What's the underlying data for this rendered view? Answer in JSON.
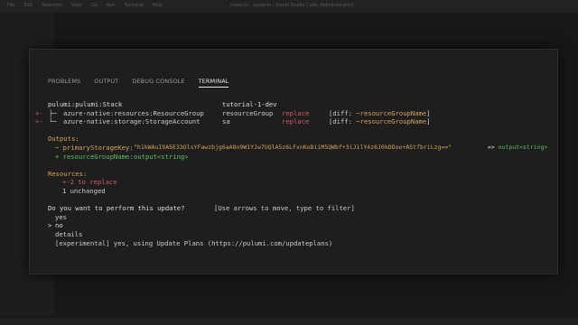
{
  "background": {
    "menu": [
      "File",
      "Edit",
      "Selection",
      "View",
      "Go",
      "Run",
      "Terminal",
      "Help"
    ],
    "window_title": "index.ts - azure-ts - Visual Studio Code (Administrator)"
  },
  "panel": {
    "tabs": [
      "PROBLEMS",
      "OUTPUT",
      "DEBUG CONSOLE",
      "TERMINAL"
    ],
    "active_tab": "TERMINAL"
  },
  "terminal": {
    "stack_row": {
      "type": "pulumi:pulumi:Stack",
      "name": "tutorial-1-dev"
    },
    "resources": [
      {
        "marker": "+-",
        "tree": "├─",
        "type": "azure-native:resources:ResourceGroup",
        "name": "resourceGroup",
        "op": "replace",
        "diff_prefix": "[diff: ",
        "diff_value": "~resourceGroupName",
        "diff_suffix": "]"
      },
      {
        "marker": "+-",
        "tree": "└─",
        "type": "azure-native:storage:StorageAccount",
        "name": "sa",
        "op": "replace",
        "diff_prefix": "[diff: ",
        "diff_value": "~resourceGroupName",
        "diff_suffix": "]"
      }
    ],
    "outputs_header": "Outputs:",
    "outputs": [
      {
        "prefix": "~ ",
        "key": "primaryStorageKey:",
        "value": "\"h1kWAuI9A5E33OlsYFawzbjg6aA8n9W1YJw7UQlA5z6LFxnKoDiiM5QWbf+3iJ1lY4z6J0kDDoo+AStfbriLzg==\"",
        "arrow": " => ",
        "new_value": "output<string>"
      },
      {
        "prefix": "+ ",
        "key": "resourceGroupName:",
        "value": "output<string>"
      }
    ],
    "resources_header": "Resources:",
    "resources_summary": [
      {
        "marker": "+-",
        "text": "2 to replace"
      },
      {
        "marker": "",
        "text": "1 unchanged"
      }
    ],
    "prompt": {
      "question": "Do you want to perform this update?",
      "hint": "[Use arrows to move, type to filter]",
      "cursor": ">",
      "options": [
        "yes",
        "no",
        "details",
        "[experimental] yes, using Update Plans (https://pulumi.com/updateplans)"
      ],
      "selected_index": 1
    }
  }
}
